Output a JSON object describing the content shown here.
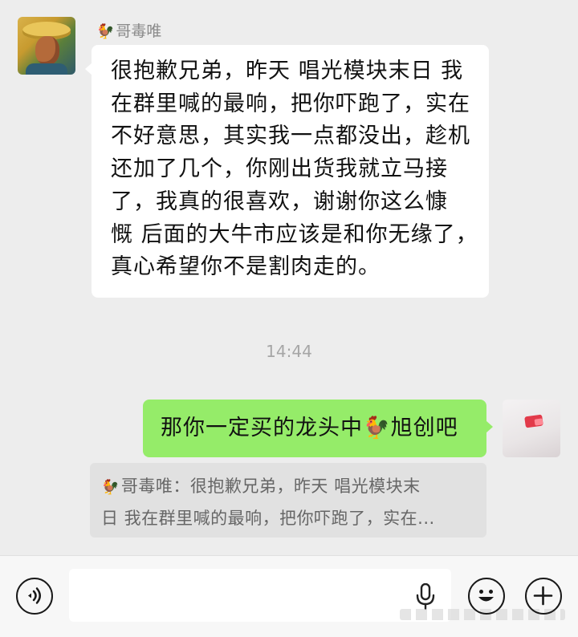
{
  "contact": {
    "name": "哥毒唯",
    "name_emoji": "🐓"
  },
  "messages": {
    "incoming_lines": [
      "很抱歉兄弟，昨天 唱光模块末日 我",
      "在群里喊的最响，把你吓跑了，实在",
      "不好意思，其实我一点都没出，趁机",
      "还加了几个，你刚出货我就立马接",
      "了，我真的很喜欢，谢谢你这么慷",
      "慨 后面的大牛市应该是和你无缘了，",
      "真心希望你不是割肉走的。"
    ],
    "timestamp": "14:44",
    "outgoing": {
      "before": "那你一定买的龙头中",
      "emoji": "🐓",
      "after": "旭创吧"
    }
  },
  "quote": {
    "emoji": "🐓",
    "line1": "哥毒唯：很抱歉兄弟，昨天 唱光模块末",
    "line2": "日 我在群里喊的最响，把你吓跑了，实在..."
  },
  "input_bar": {
    "placeholder": "",
    "icons": [
      "voice-icon",
      "microphone-icon",
      "emoji-icon",
      "plus-icon"
    ]
  }
}
